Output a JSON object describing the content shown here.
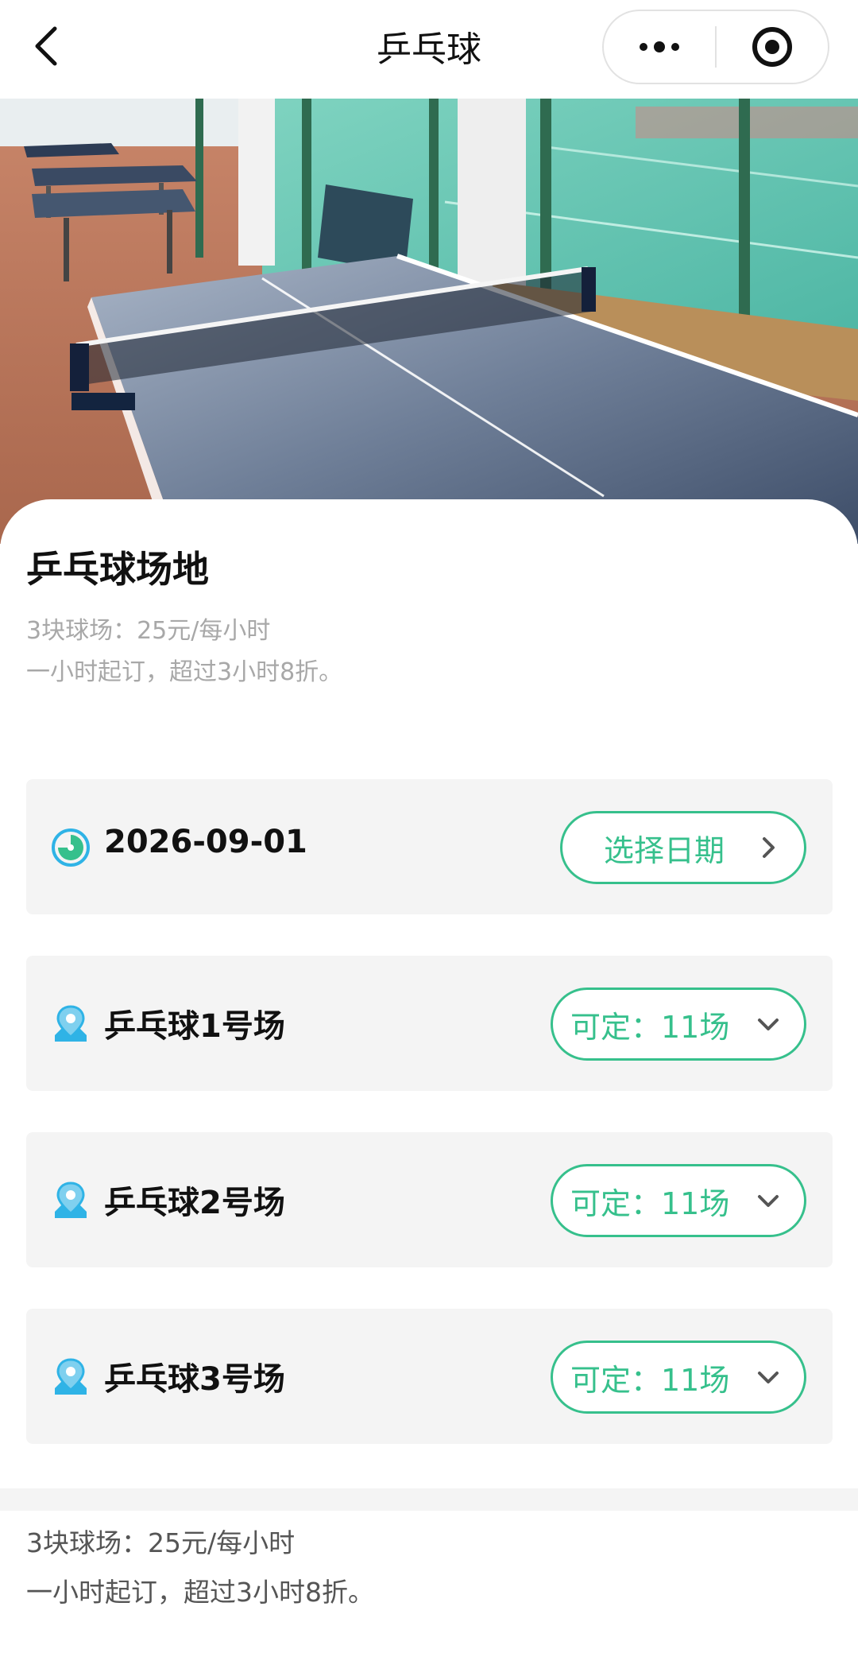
{
  "nav": {
    "title": "乒乓球"
  },
  "venue": {
    "title": "乒乓球场地",
    "desc_line1": "3块球场：25元/每小时",
    "desc_line2": "一小时起订，超过3小时8折。"
  },
  "date_row": {
    "date": "2026-09-01",
    "button_label": "选择日期"
  },
  "courts": [
    {
      "name": "乒乓球1号场",
      "availability": "可定：11场"
    },
    {
      "name": "乒乓球2号场",
      "availability": "可定：11场"
    },
    {
      "name": "乒乓球3号场",
      "availability": "可定：11场"
    }
  ],
  "footer": {
    "line1": "3块球场：25元/每小时",
    "line2": "一小时起订，超过3小时8折。"
  },
  "colors": {
    "accent": "#36c08c",
    "icon_blue": "#2fb3e6",
    "card_bg": "#f4f4f4"
  },
  "icons": [
    "back-arrow-icon",
    "more-dots-icon",
    "target-icon",
    "clock-icon",
    "chevron-right-icon",
    "location-pin-icon",
    "chevron-down-icon"
  ]
}
